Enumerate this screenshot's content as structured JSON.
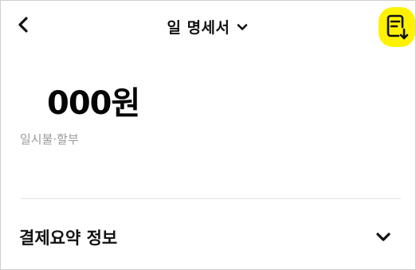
{
  "header": {
    "back_icon": "chevron-left-icon",
    "title": "일 명세서",
    "title_dropdown_icon": "chevron-down-icon",
    "doc_download_icon": "document-download-icon",
    "doc_button_highlight": "#fff200"
  },
  "summary": {
    "amount": "000원",
    "payment_type": "일시불·할부"
  },
  "section": {
    "title": "결제요약 정보",
    "expand_icon": "chevron-down-icon"
  }
}
